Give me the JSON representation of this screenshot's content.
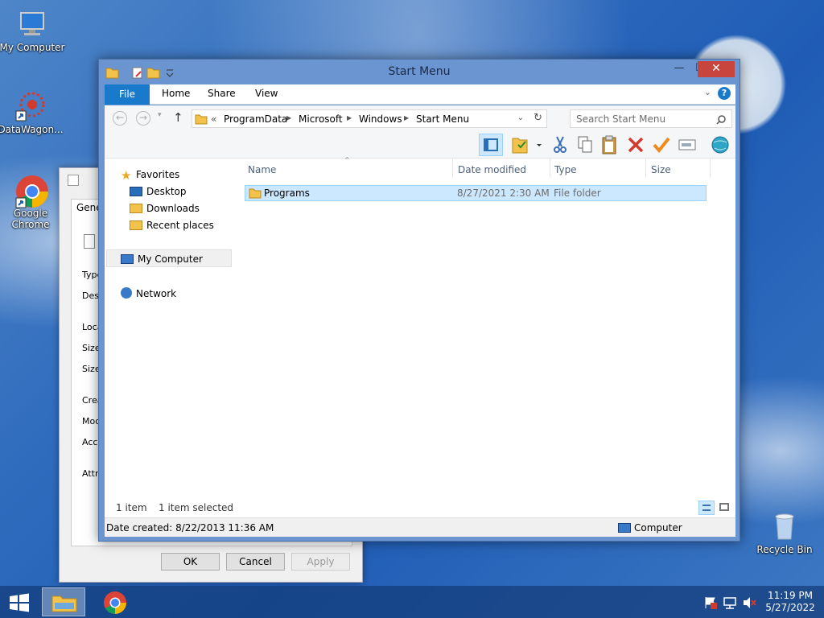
{
  "desktop": {
    "icons": [
      {
        "label": "My Computer"
      },
      {
        "label": "DataWagon..."
      },
      {
        "label": "Google Chrome"
      },
      {
        "label": "Recycle Bin"
      }
    ]
  },
  "props": {
    "tab": "Gener",
    "labels": [
      "Type",
      "Desc",
      "Loca",
      "Size",
      "Size",
      "Crea",
      "Mod",
      "Acce",
      "Attri"
    ],
    "ok": "OK",
    "cancel": "Cancel",
    "apply": "Apply"
  },
  "explorer": {
    "title": "Start Menu",
    "tabs": {
      "file": "File",
      "home": "Home",
      "share": "Share",
      "view": "View"
    },
    "breadcrumb": {
      "more": "«",
      "items": [
        "ProgramData",
        "Microsoft",
        "Windows",
        "Start Menu"
      ]
    },
    "search_placeholder": "Search Start Menu",
    "nav": {
      "favorites": "Favorites",
      "desktop": "Desktop",
      "downloads": "Downloads",
      "recent": "Recent places",
      "computer": "My Computer",
      "network": "Network"
    },
    "columns": {
      "name": "Name",
      "date": "Date modified",
      "type": "Type",
      "size": "Size"
    },
    "rows": [
      {
        "name": "Programs",
        "date": "8/27/2021 2:30 AM",
        "type": "File folder",
        "size": ""
      }
    ],
    "status": {
      "count": "1 item",
      "selected": "1 item selected"
    },
    "details": {
      "created": "Date created: 8/22/2013 11:36 AM",
      "location": "Computer"
    }
  },
  "taskbar": {
    "time": "11:19 PM",
    "date": "5/27/2022"
  },
  "colors": {
    "accent": "#1979ca",
    "selection": "#cce8ff",
    "close": "#c7453c"
  }
}
